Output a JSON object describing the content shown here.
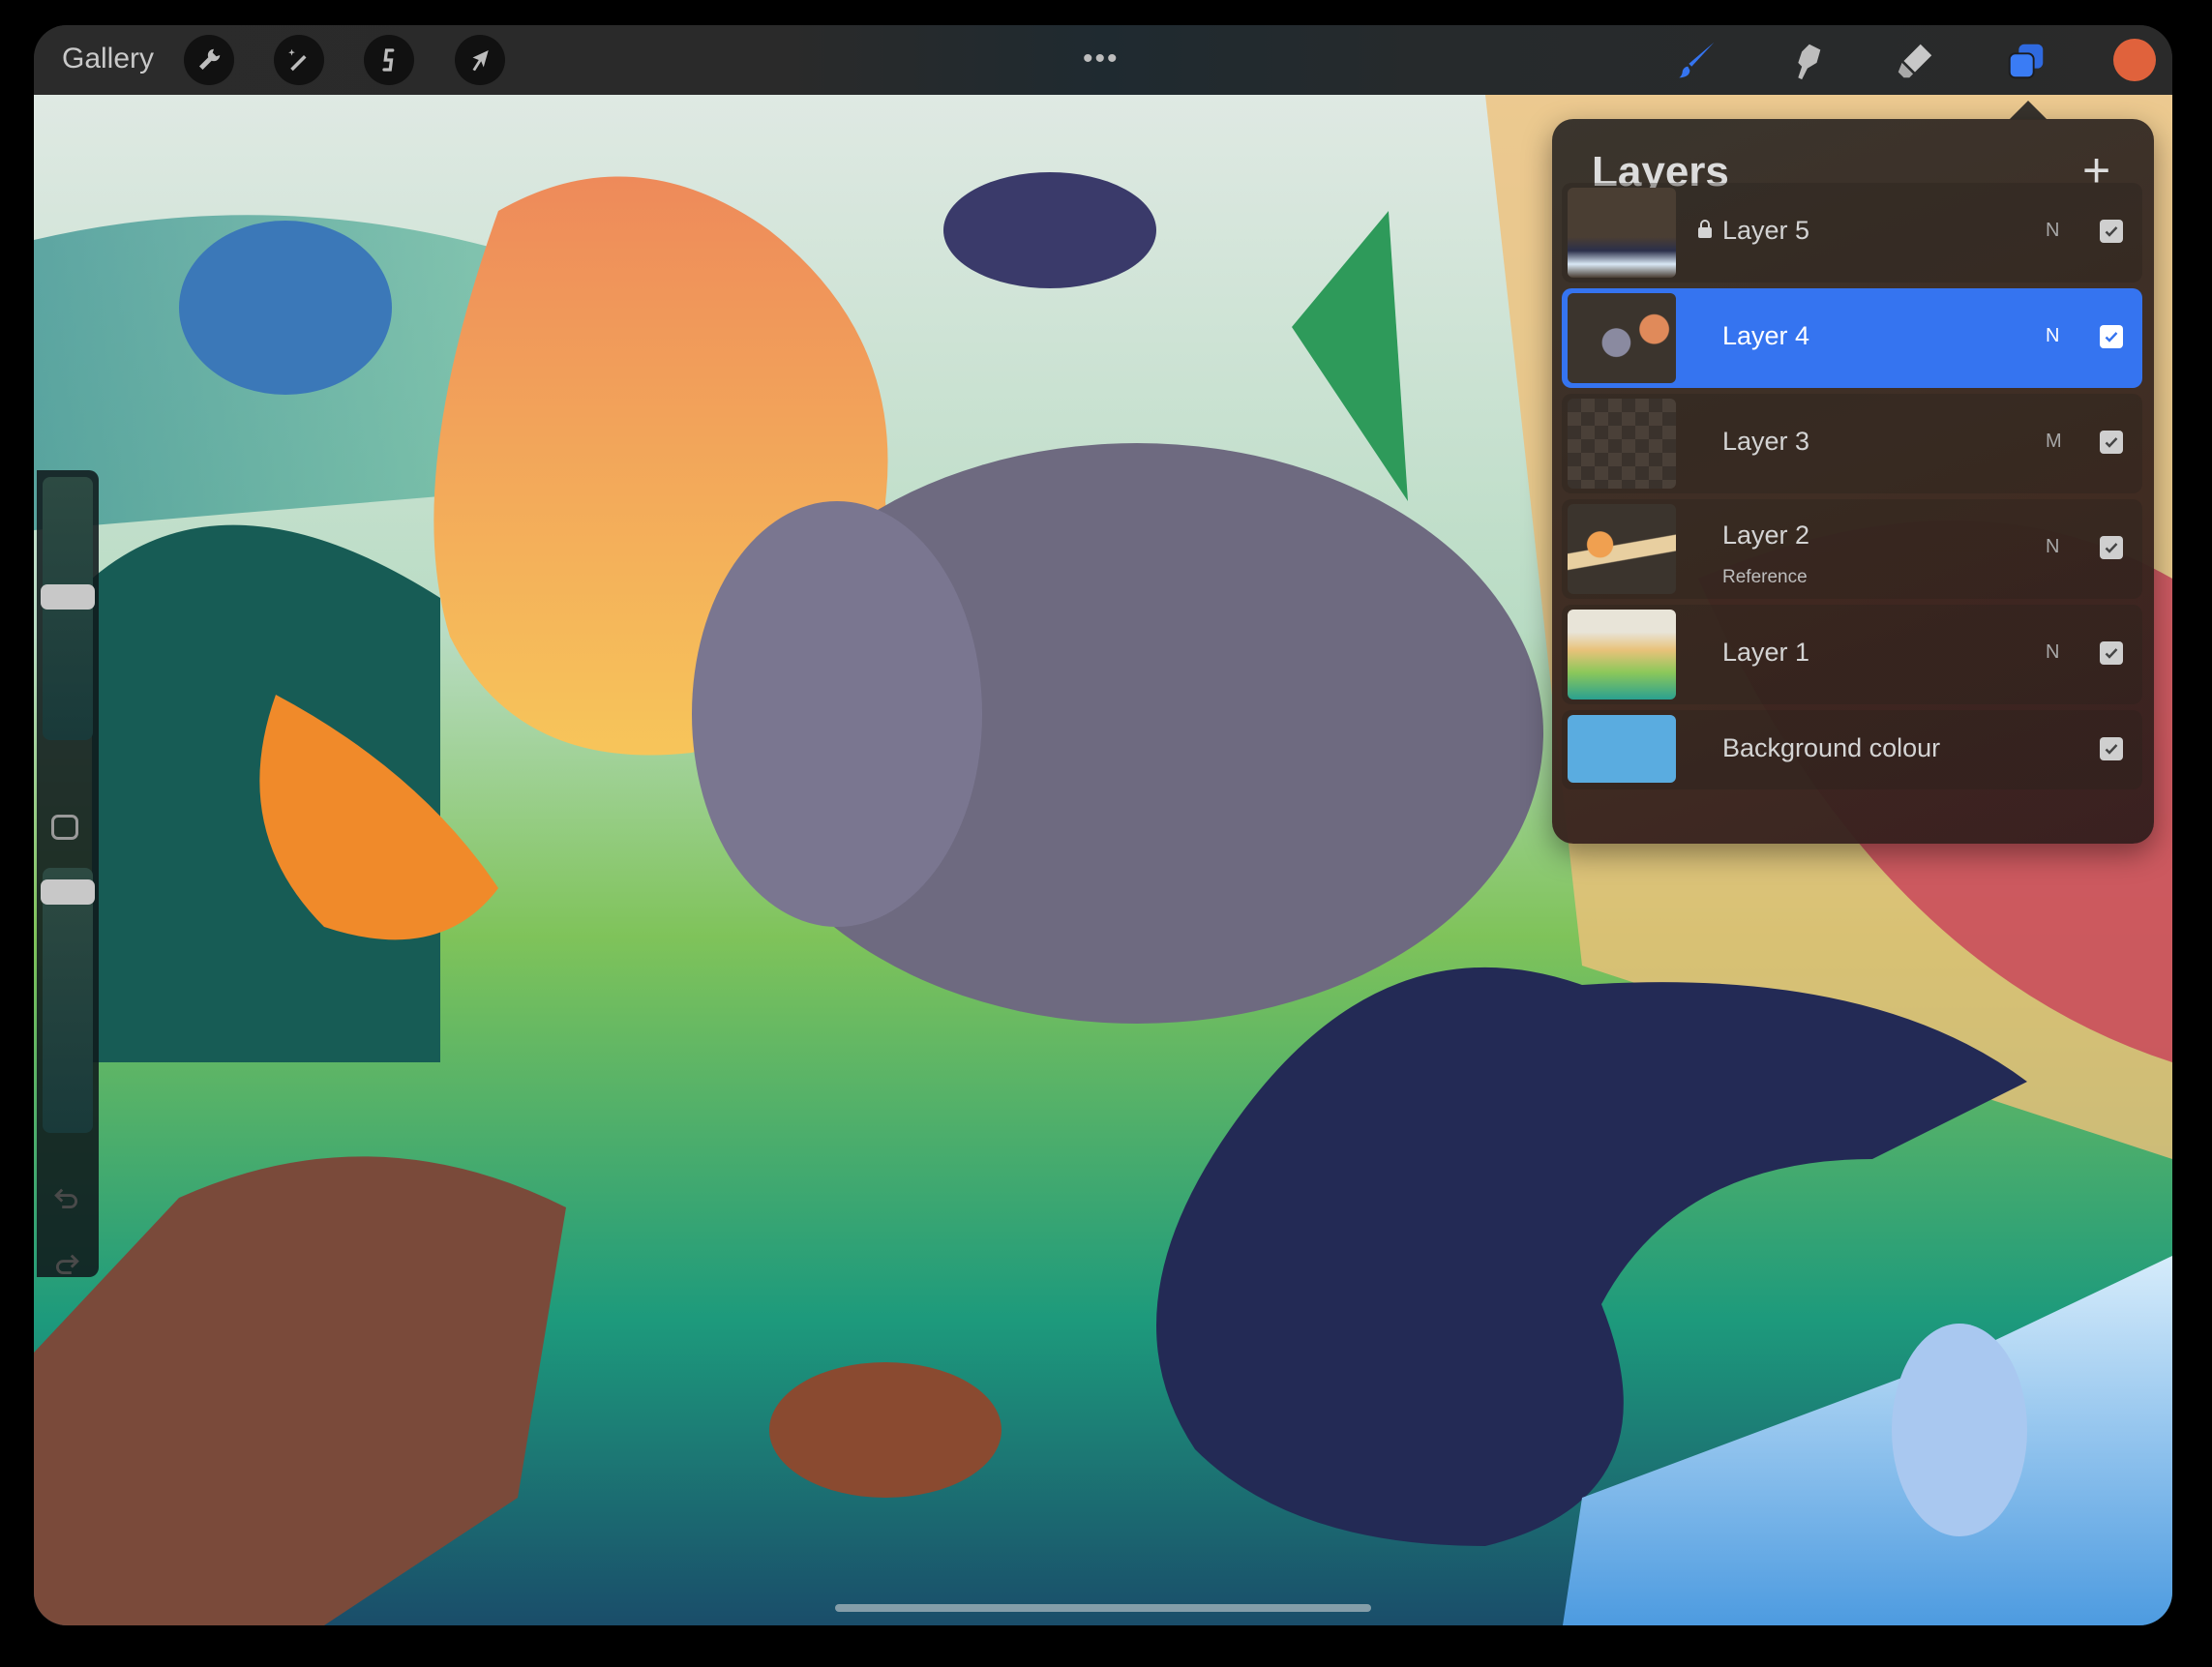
{
  "toolbar": {
    "gallery_label": "Gallery",
    "left_tools": [
      "wrench-icon",
      "magic-wand-icon",
      "selection-icon",
      "transform-arrow-icon"
    ],
    "more_label": "•••",
    "right_tools": [
      "brush-icon",
      "smudge-icon",
      "eraser-icon",
      "layers-icon"
    ],
    "current_color": "#e0623c",
    "accent_color": "#3574f0"
  },
  "layers_panel": {
    "title": "Layers",
    "add_label": "+",
    "layers": [
      {
        "name": "Layer 5",
        "blend": "N",
        "visible": true,
        "locked": true,
        "selected": false
      },
      {
        "name": "Layer 4",
        "blend": "N",
        "visible": true,
        "locked": false,
        "selected": true
      },
      {
        "name": "Layer 3",
        "blend": "M",
        "visible": true,
        "locked": false,
        "selected": false
      },
      {
        "name": "Layer 2",
        "sub": "Reference",
        "blend": "N",
        "visible": true,
        "locked": false,
        "selected": false
      },
      {
        "name": "Layer 1",
        "blend": "N",
        "visible": true,
        "locked": false,
        "selected": false
      }
    ],
    "background": {
      "name": "Background colour",
      "color": "#5aace0",
      "visible": true
    }
  },
  "sidebar": {
    "brush_size_level": 0.45,
    "opacity_level": 0.05
  }
}
